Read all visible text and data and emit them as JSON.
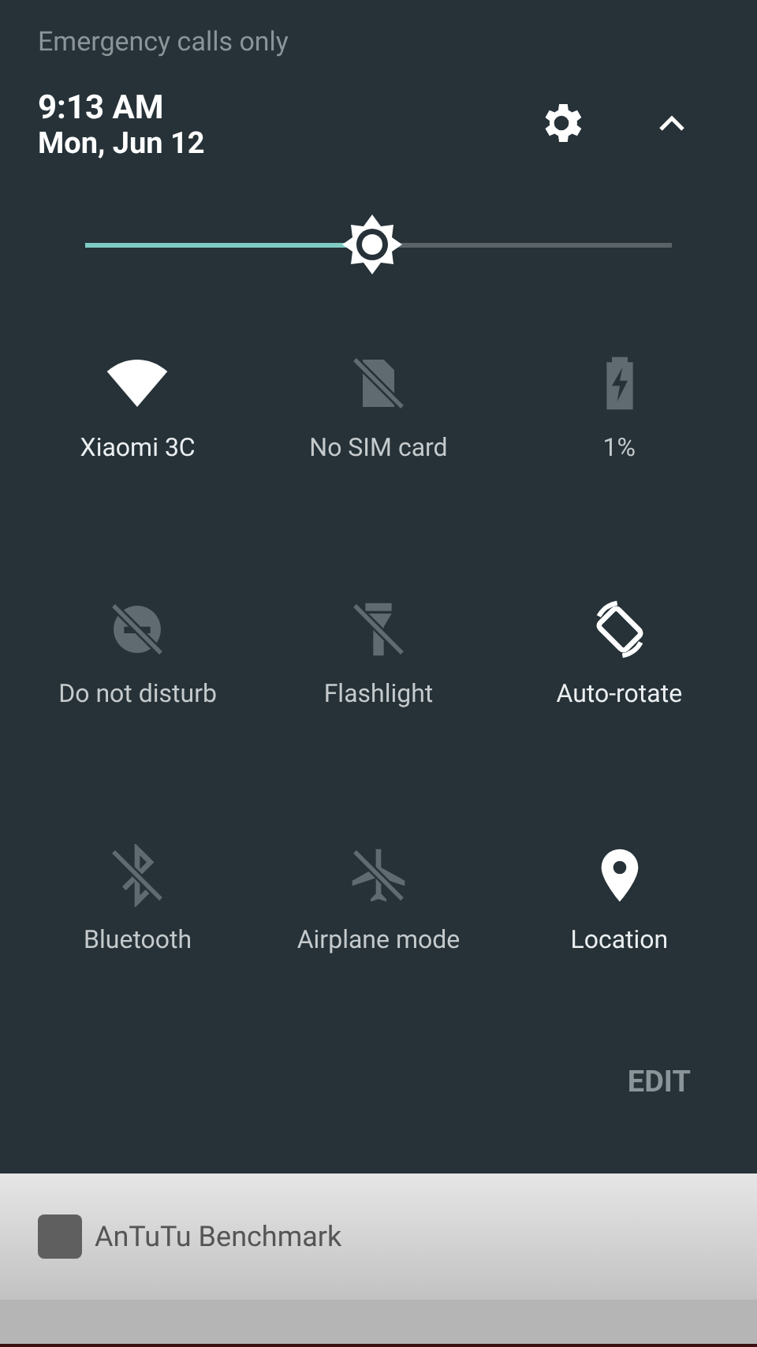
{
  "status": {
    "carrier": "Emergency calls only"
  },
  "header": {
    "time": "9:13 AM",
    "date": "Mon, Jun 12"
  },
  "brightness": {
    "level": 0.49
  },
  "tiles": [
    {
      "kind": "wifi",
      "label": "Xiaomi 3C",
      "on": true
    },
    {
      "kind": "sim",
      "label": "No SIM card",
      "on": false
    },
    {
      "kind": "battery",
      "label": "1%",
      "on": false
    },
    {
      "kind": "dnd",
      "label": "Do not disturb",
      "on": false
    },
    {
      "kind": "flashlight",
      "label": "Flashlight",
      "on": false
    },
    {
      "kind": "rotate",
      "label": "Auto-rotate",
      "on": true
    },
    {
      "kind": "bluetooth",
      "label": "Bluetooth",
      "on": false
    },
    {
      "kind": "airplane",
      "label": "Airplane mode",
      "on": false
    },
    {
      "kind": "location",
      "label": "Location",
      "on": true
    }
  ],
  "edit": "EDIT",
  "notification": {
    "title": "AnTuTu Benchmark"
  }
}
